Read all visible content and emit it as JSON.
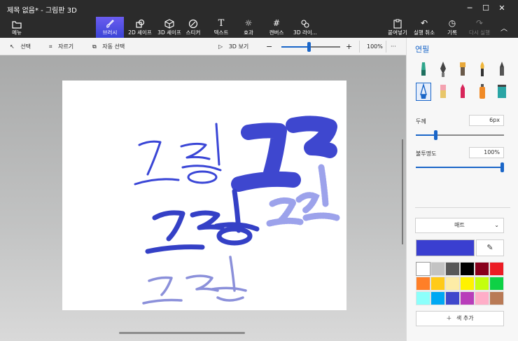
{
  "window": {
    "title": "제목 없음* - 그림판 3D",
    "controls": [
      "─",
      "☐",
      "✕"
    ]
  },
  "ribbon": {
    "menu": {
      "label": "메뉴",
      "icon": "folder-icon"
    },
    "tools": [
      {
        "label": "브러시",
        "icon": "brush-icon",
        "active": true
      },
      {
        "label": "2D 셰이프",
        "icon": "2d-shapes-icon"
      },
      {
        "label": "3D 셰이프",
        "icon": "3d-shapes-icon"
      },
      {
        "label": "스티커",
        "icon": "sticker-icon"
      },
      {
        "label": "텍스트",
        "icon": "text-icon"
      },
      {
        "label": "효과",
        "icon": "effects-icon"
      },
      {
        "label": "캔버스",
        "icon": "canvas-icon"
      },
      {
        "label": "3D 라이...",
        "icon": "3d-library-icon"
      }
    ],
    "right_tools": [
      {
        "label": "붙여넣기",
        "icon": "paste-icon"
      },
      {
        "label": "실행 취소",
        "icon": "undo-icon"
      },
      {
        "label": "기록",
        "icon": "history-icon"
      },
      {
        "label": "다시 실행",
        "icon": "redo-icon",
        "disabled": true
      }
    ]
  },
  "subbar": {
    "select": "선택",
    "crop": "자르기",
    "magic_select": "자동 선택",
    "view3d": "3D 보기",
    "zoom_minus": "−",
    "zoom_plus": "+",
    "zoom": "100%",
    "zoom_level": 0.47,
    "more": "···"
  },
  "panel": {
    "title": "연필",
    "brushes": [
      "marker-icon",
      "calligraphy-pen-icon",
      "oil-brush-icon",
      "watercolor-icon",
      "pixel-pen-icon",
      "pencil-icon",
      "eraser-icon",
      "crayon-icon",
      "spray-can-icon",
      "fill-icon"
    ],
    "thickness_label": "두께",
    "thickness_value": "6px",
    "thickness_level": 0.22,
    "opacity_label": "불투명도",
    "opacity_value": "100%",
    "opacity_level": 1.0,
    "finish_label": "매트",
    "current_color": "#3a3fd0",
    "add_color": "색 추가",
    "swatches": [
      "#ffffff",
      "#c3c3c3",
      "#585858",
      "#000000",
      "#88001b",
      "#ec1c24",
      "#ff7f27",
      "#ffca18",
      "#fdeca6",
      "#fff200",
      "#c4ff0e",
      "#0ed145",
      "#8cfffb",
      "#00a8f3",
      "#3f48cc",
      "#b83dba",
      "#ffaec8",
      "#b97a56"
    ]
  }
}
